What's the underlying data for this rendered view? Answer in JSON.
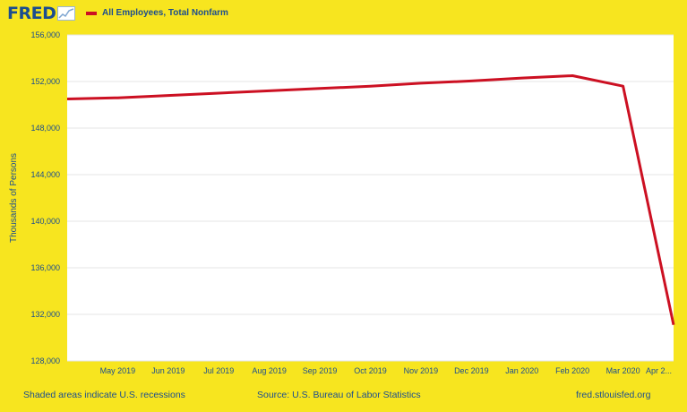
{
  "header": {
    "logo_text": "FRED",
    "logo_icon": "chart-line-icon"
  },
  "legend": {
    "label": "All Employees, Total Nonfarm",
    "color": "#cc1022"
  },
  "footer": {
    "recession_note": "Shaded areas indicate U.S. recessions",
    "source": "Source: U.S. Bureau of Labor Statistics",
    "site": "fred.stlouisfed.org"
  },
  "chart_data": {
    "type": "line",
    "title": "",
    "xlabel": "",
    "ylabel": "Thousands of Persons",
    "ylim": [
      128000,
      156000
    ],
    "yticks": [
      128000,
      132000,
      136000,
      140000,
      144000,
      148000,
      152000,
      156000
    ],
    "ytick_labels": [
      "128,000",
      "132,000",
      "136,000",
      "140,000",
      "144,000",
      "148,000",
      "152,000",
      "156,000"
    ],
    "x_tick_labels": [
      "May 2019",
      "Jun 2019",
      "Jul 2019",
      "Aug 2019",
      "Sep 2019",
      "Oct 2019",
      "Nov 2019",
      "Dec 2019",
      "Jan 2020",
      "Feb 2020",
      "Mar 2020",
      "Apr 2..."
    ],
    "x": [
      "2019-04",
      "2019-05",
      "2019-06",
      "2019-07",
      "2019-08",
      "2019-09",
      "2019-10",
      "2019-11",
      "2019-12",
      "2020-01",
      "2020-02",
      "2020-03",
      "2020-04"
    ],
    "series": [
      {
        "name": "All Employees, Total Nonfarm",
        "color": "#cc1022",
        "values": [
          150500,
          150600,
          150800,
          151000,
          151200,
          151400,
          151600,
          151850,
          152050,
          152300,
          152500,
          151600,
          131100
        ]
      }
    ],
    "grid": true,
    "legend_position": "top-left"
  }
}
